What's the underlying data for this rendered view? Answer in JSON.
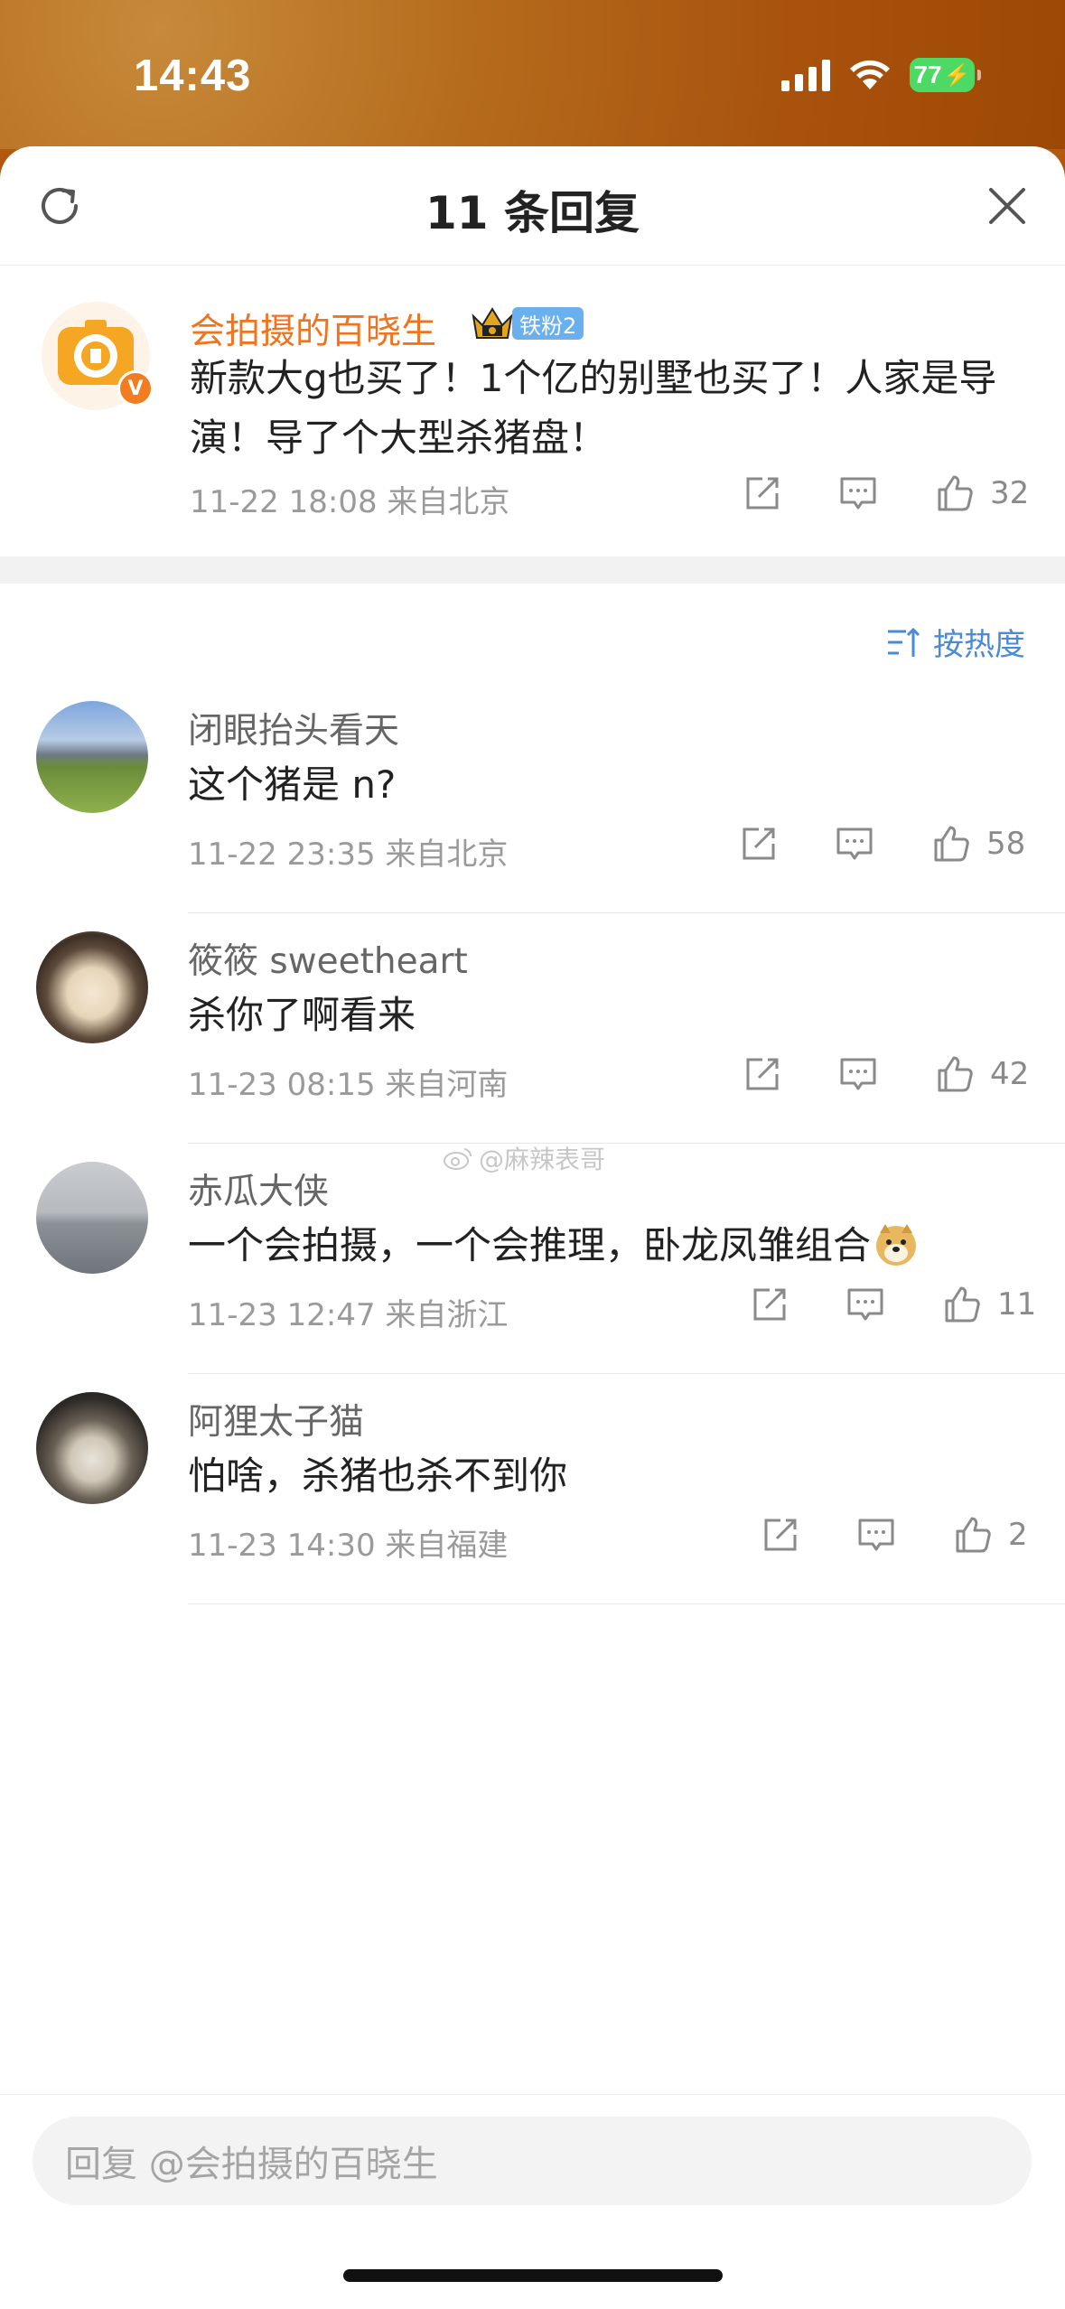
{
  "status": {
    "time": "14:43",
    "battery": "77"
  },
  "header": {
    "title": "11 条回复"
  },
  "main_comment": {
    "username": "会拍摄的百晓生",
    "fan_badge": "铁粉2",
    "text": "新款大g也买了！1个亿的别墅也买了！人家是导演！导了个大型杀猪盘！",
    "meta": "11-22 18:08 来自北京",
    "likes": "32"
  },
  "sort": {
    "label": "按热度"
  },
  "replies": [
    {
      "username": "闭眼抬头看天",
      "text": "这个猪是 n?",
      "meta": "11-22 23:35 来自北京",
      "likes": "58"
    },
    {
      "username": "筱筱 sweetheart",
      "text": "杀你了啊看来",
      "meta": "11-23 08:15 来自河南",
      "likes": "42"
    },
    {
      "username": "赤瓜大侠",
      "text": "一个会拍摄，一个会推理，卧龙凤雏组合",
      "meta": "11-23 12:47 来自浙江",
      "likes": "11"
    },
    {
      "username": "阿狸太子猫",
      "text": "怕啥，杀猪也杀不到你",
      "meta": "11-23 14:30 来自福建",
      "likes": "2"
    }
  ],
  "watermark": "@麻辣表哥",
  "input": {
    "placeholder": "回复 @会拍摄的百晓生"
  },
  "colors": {
    "accent": "#f0731e",
    "link": "#4a8ad6",
    "fan_badge": "#6ab0ef"
  }
}
